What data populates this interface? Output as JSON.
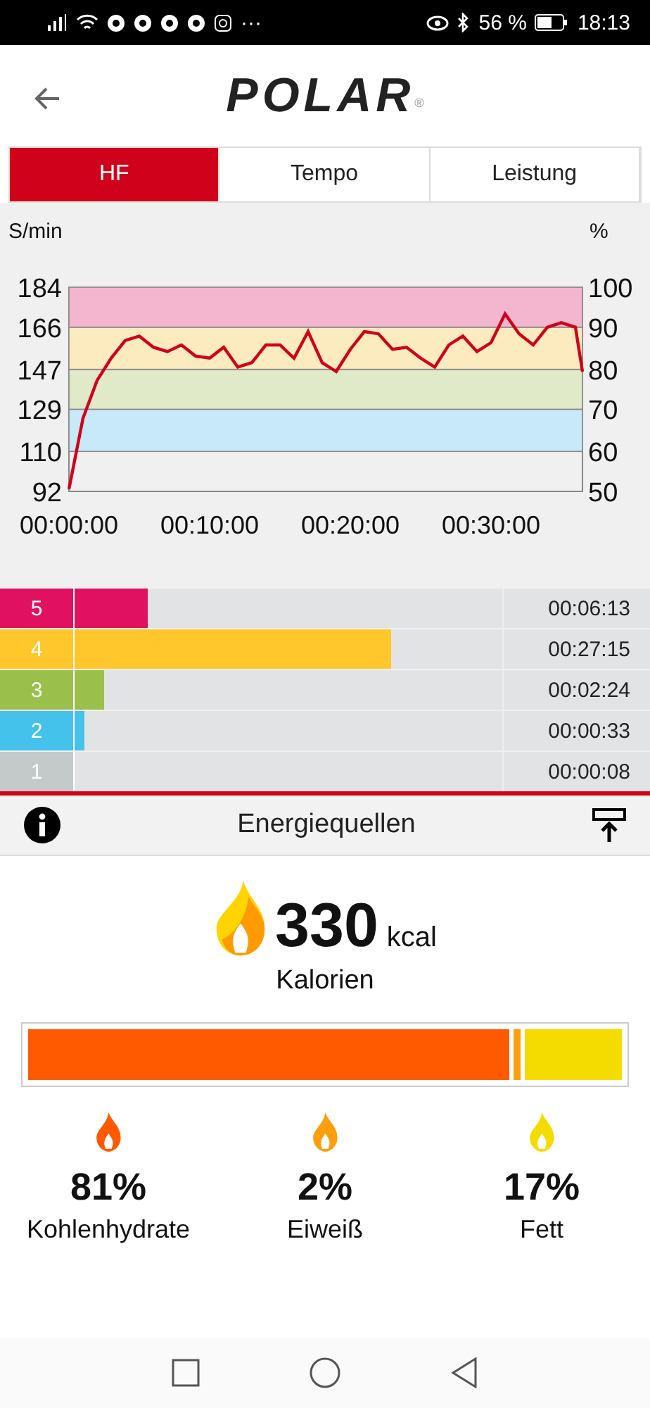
{
  "status_bar": {
    "battery": "56 %",
    "time": "18:13",
    "more": "···"
  },
  "header": {
    "logo": "POLAR",
    "logo_mark": "®"
  },
  "tabs": [
    {
      "label": "HF",
      "selected": true
    },
    {
      "label": "Tempo",
      "selected": false
    },
    {
      "label": "Leistung",
      "selected": false
    }
  ],
  "chart": {
    "left_unit": "S/min",
    "right_unit": "%",
    "right_ticks": [
      "100",
      "90",
      "80",
      "70",
      "60",
      "50"
    ],
    "chart_data": {
      "type": "line",
      "x": [
        0,
        1,
        2,
        3,
        4,
        5,
        6,
        7,
        8,
        9,
        10,
        11,
        12,
        13,
        14,
        15,
        16,
        17,
        18,
        19,
        20,
        21,
        22,
        23,
        24,
        25,
        26,
        27,
        28,
        29,
        30,
        31,
        32,
        33,
        34,
        35,
        36,
        36.5
      ],
      "series": [
        {
          "color": "#d0021b",
          "values": [
            93,
            125,
            142,
            152,
            160,
            162,
            157,
            155,
            158,
            153,
            152,
            157,
            148,
            150,
            158,
            158,
            152,
            164,
            150,
            146,
            156,
            164,
            163,
            156,
            157,
            152,
            148,
            158,
            162,
            155,
            159,
            172,
            163,
            158,
            166,
            168,
            166,
            146
          ]
        }
      ],
      "bands": [
        {
          "axis": "y",
          "from": 110,
          "to": 129,
          "color": "#c8e9f7"
        },
        {
          "axis": "y",
          "from": 129,
          "to": 147,
          "color": "#e0e9c8"
        },
        {
          "axis": "y",
          "from": 147,
          "to": 166,
          "color": "#fdebc0"
        },
        {
          "axis": "y",
          "from": 166,
          "to": 184,
          "color": "#f4b6cf"
        }
      ],
      "xlim": [
        0,
        36.5
      ],
      "ylim": [
        92,
        184
      ],
      "yticks": [
        92,
        110,
        129,
        147,
        166,
        184
      ],
      "xticks": [
        {
          "value": 0,
          "label": "00:00:00"
        },
        {
          "value": 10,
          "label": "00:10:00"
        },
        {
          "value": 20,
          "label": "00:20:00"
        },
        {
          "value": 30,
          "label": "00:30:00"
        }
      ]
    }
  },
  "zones": [
    {
      "number": "5",
      "time": "00:06:13",
      "level": 0.17,
      "color": "#e0115f"
    },
    {
      "number": "4",
      "time": "00:27:15",
      "level": 0.74,
      "color": "#ffc72c"
    },
    {
      "number": "3",
      "time": "00:02:24",
      "level": 0.07,
      "color": "#9bbf4b"
    },
    {
      "number": "2",
      "time": "00:00:33",
      "level": 0.023,
      "color": "#45c2ec"
    },
    {
      "number": "1",
      "time": "00:00:08",
      "color": "#c4c9ca"
    }
  ],
  "section": {
    "title": "Energiequellen"
  },
  "calories": {
    "value": "330",
    "unit": "kcal",
    "label": "Kalorien"
  },
  "energy_bar": [
    {
      "level": 0.81,
      "color": "#ff5a00"
    },
    {
      "color": "#ff9e0d"
    },
    {
      "level": 0.17,
      "color": "#f5dc00"
    }
  ],
  "energy_sources": [
    {
      "percent": "81%",
      "label": "Kohlenhydrate",
      "color": "#ff5a00"
    },
    {
      "percent": "2%",
      "label": "Eiweiß",
      "color": "#ff9e0d"
    },
    {
      "percent": "17%",
      "label": "Fett",
      "color": "#f5dc00"
    }
  ]
}
